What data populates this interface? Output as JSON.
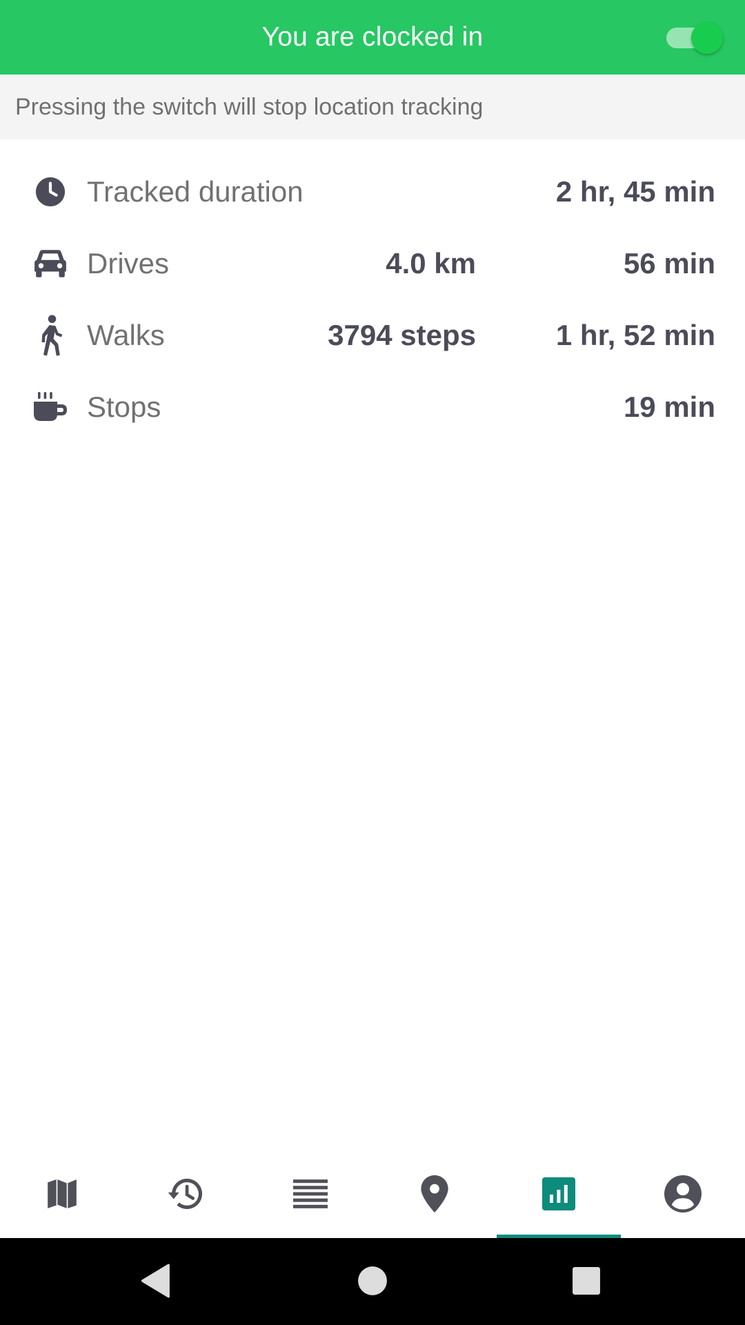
{
  "header": {
    "title": "You are clocked in",
    "switch_on": true,
    "accent_color": "#27c763"
  },
  "subheader": {
    "text": "Pressing the switch will stop location tracking"
  },
  "stats": [
    {
      "icon": "clock-icon",
      "label": "Tracked duration",
      "middle": "",
      "right": "2 hr, 45 min"
    },
    {
      "icon": "car-icon",
      "label": "Drives",
      "middle": "4.0 km",
      "right": "56 min"
    },
    {
      "icon": "walk-icon",
      "label": "Walks",
      "middle": "3794 steps",
      "right": "1 hr, 52 min"
    },
    {
      "icon": "coffee-icon",
      "label": "Stops",
      "middle": "",
      "right": "19 min"
    }
  ],
  "bottom_nav": {
    "active_index": 4,
    "active_color": "#0d8b7c",
    "items": [
      {
        "icon": "map-icon"
      },
      {
        "icon": "history-icon"
      },
      {
        "icon": "list-icon"
      },
      {
        "icon": "location-pin-icon"
      },
      {
        "icon": "stats-icon"
      },
      {
        "icon": "account-icon"
      }
    ]
  },
  "system_nav": {
    "items": [
      "back-icon",
      "home-icon",
      "recents-icon"
    ]
  }
}
